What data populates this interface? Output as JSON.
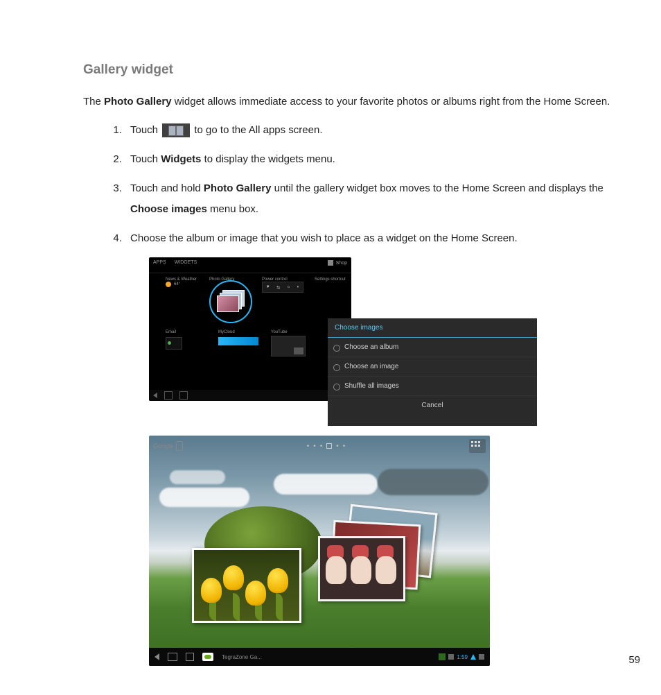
{
  "heading": "Gallery widget",
  "intro": {
    "pre": "The ",
    "bold": "Photo Gallery",
    "post": " widget allows immediate access to your favorite photos or albums right from the Home Screen."
  },
  "steps": {
    "s1_pre": "Touch ",
    "s1_post": " to go to the All apps screen.",
    "s2_pre": "Touch ",
    "s2_bold": "Widgets",
    "s2_post": " to display the widgets menu.",
    "s3_pre": "Touch and hold ",
    "s3_bold1": "Photo Gallery",
    "s3_mid": " until the gallery widget box moves to the Home Screen and displays the ",
    "s3_bold2": "Choose images",
    "s3_post": " menu box.",
    "s4": "Choose the album or image that you wish to place as a widget on the Home Screen."
  },
  "widget_screen": {
    "tab_apps": "APPS",
    "tab_widgets": "WIDGETS",
    "shop": "Shop",
    "row_labels": [
      "News & Weather",
      "Photo Gallery",
      "Power control",
      "Settings shortcut"
    ],
    "temp": "64°",
    "row2_labels": [
      "Email",
      "MyCloud",
      "YouTube"
    ]
  },
  "choose_dialog": {
    "title": "Choose images",
    "opt1": "Choose an album",
    "opt2": "Choose an image",
    "opt3": "Shuffle all images",
    "cancel": "Cancel"
  },
  "home_screen": {
    "search": "Google",
    "tegra": "TegraZone Ga...",
    "time": "1:59"
  },
  "page_number": "59"
}
